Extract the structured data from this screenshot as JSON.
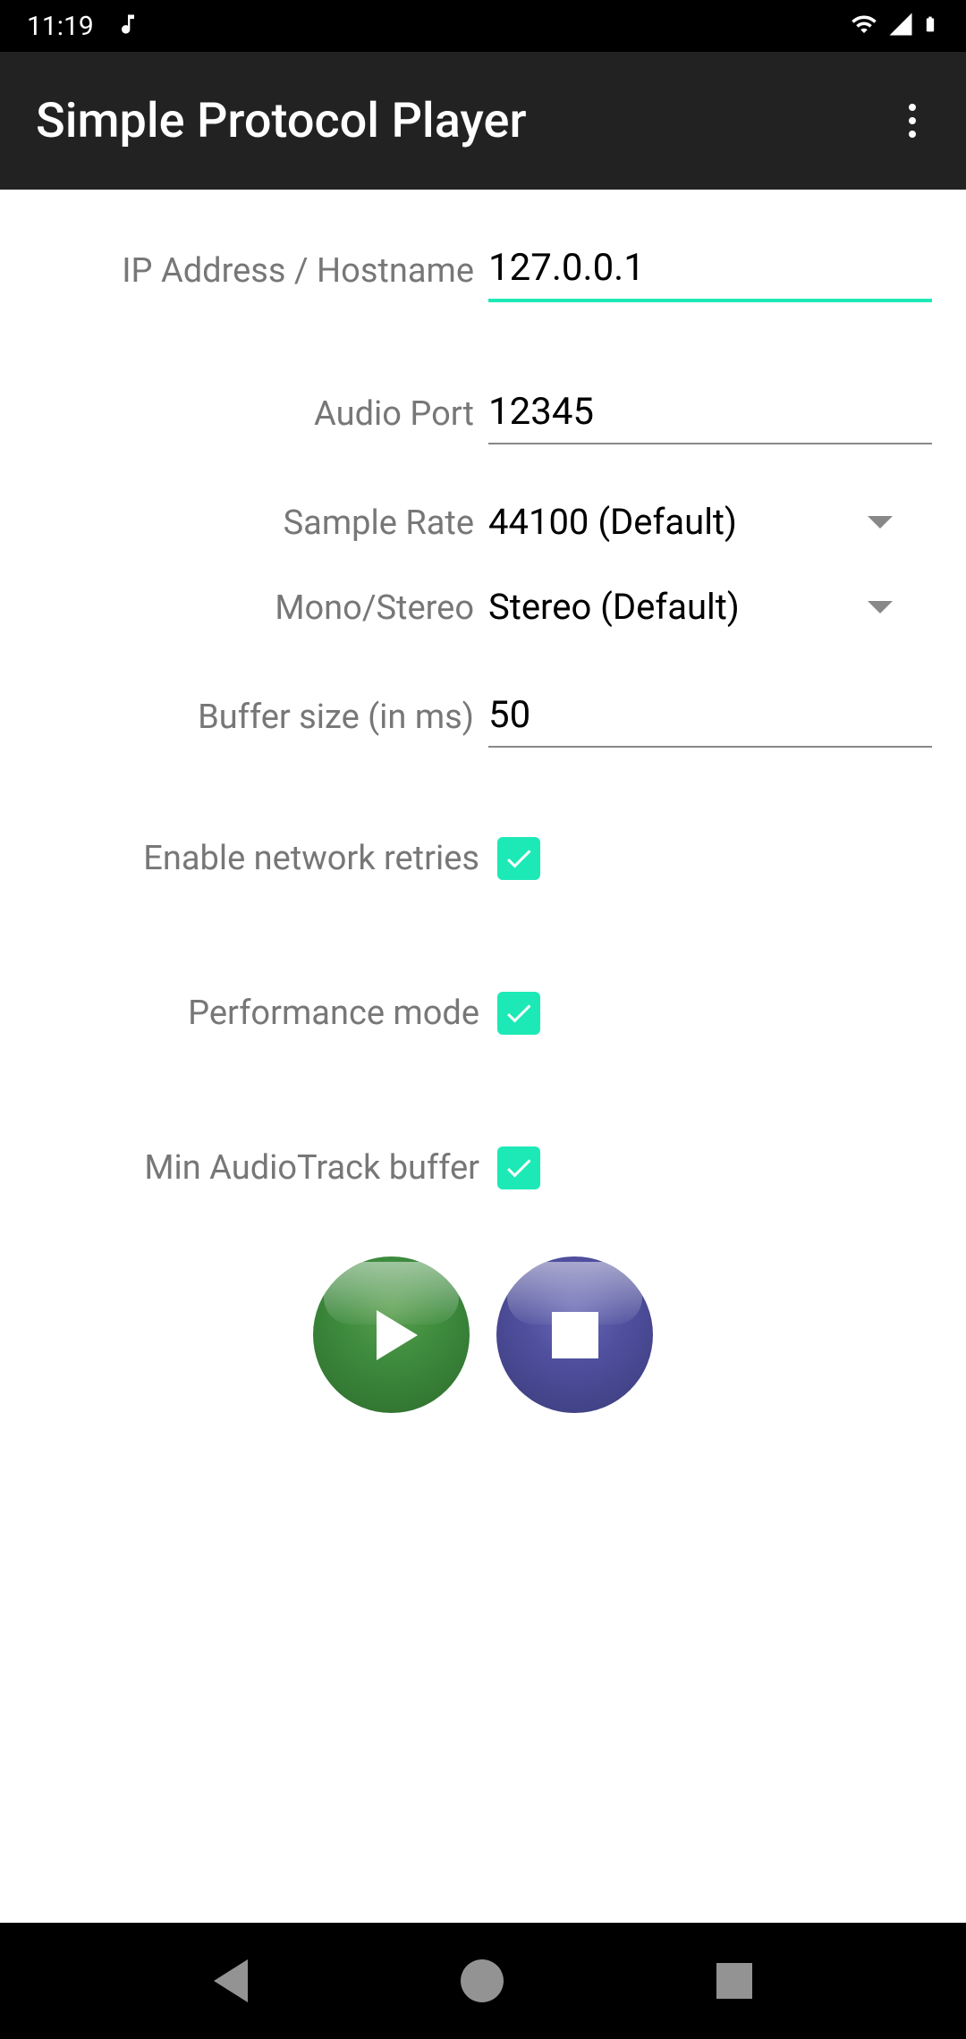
{
  "status_bar": {
    "time": "11:19"
  },
  "action_bar": {
    "title": "Simple Protocol Player"
  },
  "form": {
    "ip_label": "IP Address / Hostname",
    "ip_value": "127.0.0.1",
    "port_label": "Audio Port",
    "port_value": "12345",
    "sample_rate_label": "Sample Rate",
    "sample_rate_value": "44100 (Default)",
    "channels_label": "Mono/Stereo",
    "channels_value": "Stereo (Default)",
    "buffer_label": "Buffer size (in ms)",
    "buffer_value": "50",
    "retries_label": "Enable network retries",
    "retries_checked": true,
    "performance_label": "Performance mode",
    "performance_checked": true,
    "min_buffer_label": "Min AudioTrack buffer",
    "min_buffer_checked": true
  }
}
